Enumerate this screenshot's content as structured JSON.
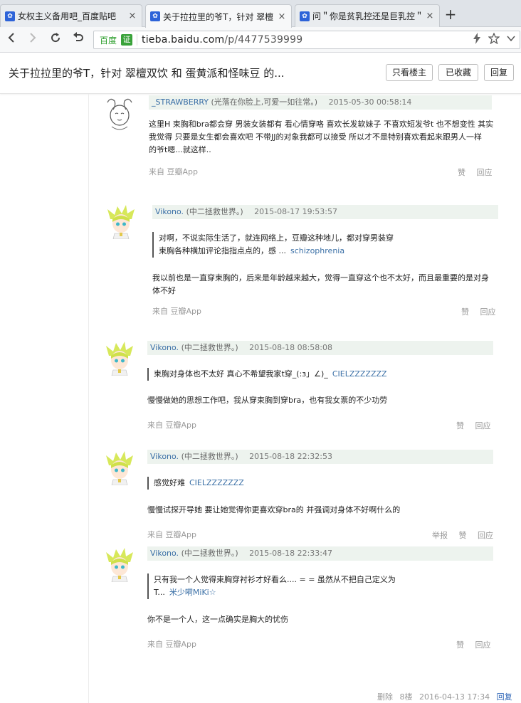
{
  "browser": {
    "tabs": [
      {
        "title": "女权主义备用吧_百度贴吧",
        "active": false
      },
      {
        "title": "关于拉拉里的爷T，针对 翠檀",
        "active": true
      },
      {
        "title": "问＂你是贫乳控还是巨乳控＂",
        "active": false
      }
    ],
    "close_glyph": "×",
    "new_tab": "+",
    "omnibox": {
      "baidu_label": "百度",
      "verified_label": "证",
      "url_host": "tieba.baidu.com",
      "url_path": "/p/4477539999"
    }
  },
  "header": {
    "title": "关于拉拉里的爷T，针对 翠檀双饮 和 蛋黄派和怪味豆 的...",
    "buttons": {
      "only_owner": "只看楼主",
      "favorited": "已收藏",
      "reply": "回复"
    }
  },
  "posts": [
    {
      "user": "_STRAWBERRY",
      "signature": "(光落在你脸上,可爱一如往常。)",
      "time": "2015-05-30 00:58:14",
      "body_lines": [
        "这里H 束胸和bra都会穿 男装女装都有 看心情穿咯 喜欢长发软妹子 不喜欢短发爷t 也不想变性 其实",
        "我觉得 只要是女生都会喜欢吧 不带JJ的对象我都可以接受 所以才不是特别喜欢看起来跟男人一样",
        "的爷t嗯...就这样.."
      ],
      "source": "来自 豆瓣App",
      "actions": [
        "赞",
        "回应"
      ]
    },
    {
      "user": "Vikono.",
      "signature": "(中二拯救世界。)",
      "time": "2015-08-17 19:53:57",
      "quote_lines": [
        "对啊，不说实际生活了，就连网络上，豆瓣这种地儿，都对穿男装穿",
        "束胸各种横加评论指指点点的，感 ..."
      ],
      "quote_user": "schizophrenia",
      "body_lines": [
        "我以前也是一直穿束胸的，后来是年龄越来越大，觉得一直穿这个也不太好，而且最重要的是对身",
        "体不好"
      ],
      "source": "来自 豆瓣App",
      "actions": [
        "赞",
        "回应"
      ]
    },
    {
      "user": "Vikono.",
      "signature": "(中二拯救世界。)",
      "time": "2015-08-18 08:58:08",
      "quote_lines": [
        "束胸对身体也不太好 真心不希望我家t穿_(:з」∠)_"
      ],
      "quote_user": "CIELZZZZZZZ",
      "body_lines": [
        "慢慢做她的思想工作吧，我从穿束胸到穿bra，也有我女票的不少功劳"
      ],
      "source": "来自 豆瓣App",
      "actions": [
        "赞",
        "回应"
      ]
    },
    {
      "user": "Vikono.",
      "signature": "(中二拯救世界。)",
      "time": "2015-08-18 22:32:53",
      "quote_lines": [
        "感觉好难"
      ],
      "quote_user": "CIELZZZZZZZ",
      "body_lines": [
        "慢慢试探开导她 要让她觉得你更喜欢穿bra的 并强调对身体不好啊什么的"
      ],
      "source": "来自 豆瓣App",
      "actions": [
        "举报",
        "赞",
        "回应"
      ]
    },
    {
      "user": "Vikono.",
      "signature": "(中二拯救世界。)",
      "time": "2015-08-18 22:33:47",
      "quote_lines": [
        "只有我一个人觉得束胸穿衬衫才好看么.... = = 虽然从不把自己定义为",
        "T..."
      ],
      "quote_user": "米少嗬MiKi☆",
      "body_lines": [
        "你不是一个人，这一点确实是胸大的忧伤"
      ],
      "source": "来自 豆瓣App",
      "actions": [
        "赞",
        "回应"
      ]
    }
  ],
  "footer": {
    "delete": "删除",
    "floor": "8楼",
    "time": "2016-04-13 17:34",
    "reply": "回复"
  }
}
